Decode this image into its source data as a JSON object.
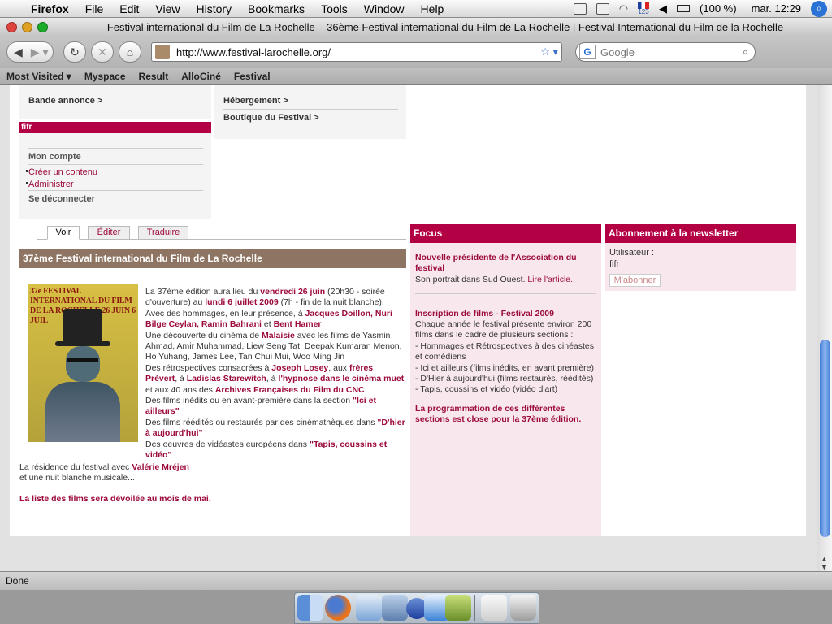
{
  "menubar": {
    "app": "Firefox",
    "items": [
      "File",
      "Edit",
      "View",
      "History",
      "Bookmarks",
      "Tools",
      "Window",
      "Help"
    ],
    "keyboard_badge": "123",
    "battery": "(100 %)",
    "clock": "mar. 12:29"
  },
  "window": {
    "title": "Festival international du Film de La Rochelle – 36ème Festival international du Film de La Rochelle | Festival International du Film de la Rochelle"
  },
  "navbar": {
    "url": "http://www.festival-larochelle.org/",
    "search_placeholder": "Google"
  },
  "bookmarks": [
    "Most Visited ▾",
    "Myspace",
    "Result",
    "AlloCiné",
    "Festival"
  ],
  "page": {
    "left_box": {
      "bande_annonce": "Bande annonce >"
    },
    "right_box": {
      "hebergement": "Hébergement >",
      "boutique": "Boutique du Festival >"
    },
    "user_header": "fifr",
    "user_menu": {
      "mon_compte": "Mon compte",
      "creer": "Créer un contenu",
      "admin": "Administrer",
      "deconnecter": "Se déconnecter"
    },
    "tabs": [
      "Voir",
      "Éditer",
      "Traduire"
    ],
    "article": {
      "title": "37ème Festival international du Film de La Rochelle",
      "poster_text": "37e FESTIVAL INTERNATIONAL DU FILM DE LA ROCHELLE 26 JUIN 6 JUIL",
      "p1a": "La 37ème édition aura lieu du ",
      "p1b": "vendredi 26 juin",
      "p1c": " (20h30 - soirée d'ouverture) au ",
      "p1d": "lundi 6 juillet 2009",
      "p1e": " (7h - fin de la nuit blanche).",
      "p2a": "Avec des hommages, en leur présence, à ",
      "p2b": "Jacques Doillon, Nuri Bilge Ceylan, Ramin Bahrani",
      "p2c": " et ",
      "p2d": "Bent Hamer",
      "p3a": "Une découverte du cinéma de ",
      "p3b": "Malaisie",
      "p3c": "  avec les films de Yasmin Ahmad, Amir Muhammad, Liew Seng Tat, Deepak Kumaran Menon, Ho Yuhang, James Lee, Tan Chui Mui, Woo Ming Jin",
      "p4a": "Des rétrospectives consacrées à ",
      "p4b": "Joseph Losey",
      "p4c": ", aux ",
      "p4d": "frères Prévert",
      "p4e": ", à ",
      "p4f": "Ladislas Starewitch",
      "p4g": ", à ",
      "p4h": "l'hypnose dans le cinéma muet",
      "p4i": " et aux 40 ans des ",
      "p4j": "Archives Françaises du Film du CNC",
      "p5a": "Des films inédits ou en avant-première dans la section ",
      "p5b": "\"Ici et ailleurs\"",
      "p6a": "Des films réédités ou restaurés par des cinémathèques dans ",
      "p6b": "\"D'hier à aujourd'hui\"",
      "p7a": "Des oeuvres de vidéastes européens dans ",
      "p7b": "\"Tapis, coussins et vidéo\"",
      "p8a": "La résidence du festival avec ",
      "p8b": "Valérie Mréjen",
      "p9": "et une nuit blanche musicale...",
      "p10": "La liste des films sera dévoilée au mois de mai."
    },
    "focus": {
      "header": "Focus",
      "item1_title": "Nouvelle présidente de l'Association du festival",
      "item1_text": "Son portrait dans Sud Ouest. ",
      "item1_link": "Lire l'article.",
      "item2_title": "Inscription de films - Festival 2009",
      "item2_text1": "Chaque année le festival présente environ 200 films dans le cadre de plusieurs sections :",
      "item2_li1": "- Hommages et Rétrospectives à des cinéastes et comédiens",
      "item2_li2": "- Ici et ailleurs (films inédits, en avant première)",
      "item2_li3": "- D'Hier à aujourd'hui (films restaurés, réédités)",
      "item2_li4": "- Tapis, coussins et vidéo (vidéo d'art)",
      "item2_footer": "La programmation de ces différentes sections est close pour la 37ème édition."
    },
    "newsletter": {
      "header": "Abonnement à la newsletter",
      "user_label": "Utilisateur :",
      "user_value": "fifr",
      "button": "M'abonner"
    }
  },
  "status": "Done",
  "colors": {
    "accent": "#b30044",
    "link": "#9c0a3e",
    "title_bar": "#8e7462",
    "pink_bg": "#f8e8ee"
  }
}
